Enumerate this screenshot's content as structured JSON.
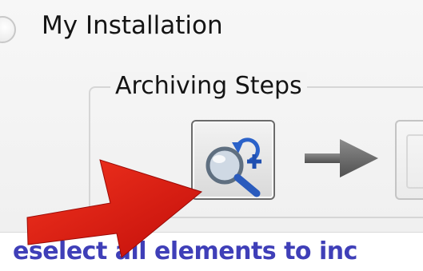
{
  "installation": {
    "label": "My Installation"
  },
  "archiving": {
    "group_title": "Archiving Steps",
    "step_icon": "magnifier-refresh-add-icon",
    "flow_icon": "arrow-right-icon",
    "next_step_icon": "step-placeholder-icon"
  },
  "hint": {
    "text": "eselect all elements to inc"
  },
  "colors": {
    "hint_text": "#3f3fb8",
    "callout_arrow": "#e01a12",
    "flow_arrow": "#6e6e6e"
  }
}
